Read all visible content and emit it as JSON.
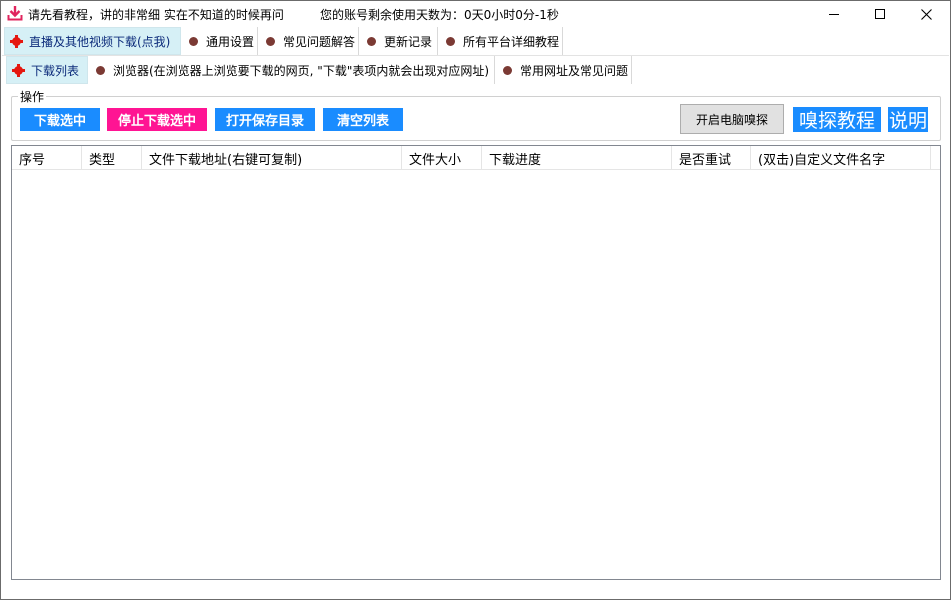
{
  "titlebar": {
    "title": "请先看教程，讲的非常细  实在不知道的时候再问",
    "days_left": "您的账号剩余使用天数为：0天0小时0分-1秒",
    "icon": "download-icon",
    "accent": "#e0245e"
  },
  "tabs_main": [
    {
      "label": "直播及其他视频下载(点我)",
      "active": true
    },
    {
      "label": "通用设置",
      "active": false
    },
    {
      "label": "常见问题解答",
      "active": false
    },
    {
      "label": "更新记录",
      "active": false
    },
    {
      "label": "所有平台详细教程",
      "active": false
    }
  ],
  "tabs_sub": [
    {
      "label": "下载列表",
      "active": true
    },
    {
      "label": "浏览器(在浏览器上浏览要下载的网页, \"下载\"表项内就会出现对应网址)",
      "active": false
    },
    {
      "label": "常用网址及常见问题",
      "active": false
    }
  ],
  "operations": {
    "legend": "操作",
    "download_selected": "下载选中",
    "stop_selected": "停止下载选中",
    "open_folder": "打开保存目录",
    "clear_list": "清空列表",
    "start_sniff": "开启电脑嗅探",
    "sniff_tutorial": "嗅探教程",
    "help": "说明"
  },
  "table": {
    "columns": [
      "序号",
      "类型",
      "文件下载地址(右键可复制)",
      "文件大小",
      "下载进度",
      "是否重试",
      "(双击)自定义文件名字"
    ],
    "rows": []
  },
  "colors": {
    "button_blue": "#1a8cff",
    "button_pink": "#ff1493",
    "active_tab": "#d6f0f6"
  }
}
